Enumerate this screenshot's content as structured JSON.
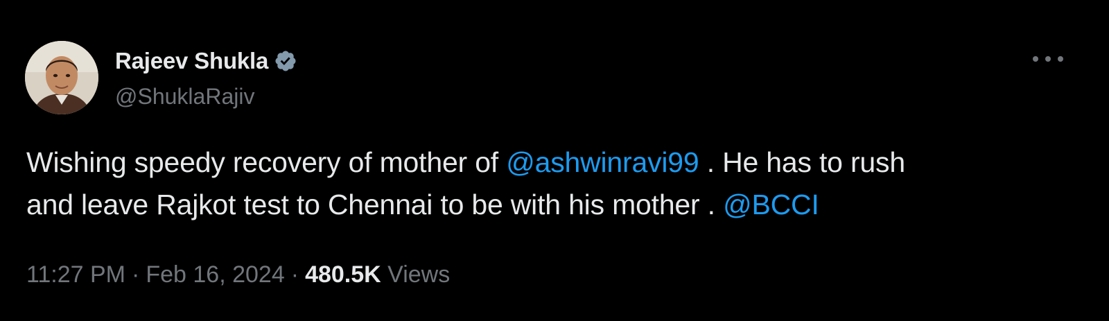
{
  "user": {
    "display_name": "Rajeev Shukla",
    "handle": "@ShuklaRajiv",
    "verified": true,
    "avatar": "profile-photo"
  },
  "tweet": {
    "segments": [
      {
        "type": "text",
        "value": "Wishing speedy recovery of mother of "
      },
      {
        "type": "mention",
        "value": "@ashwinravi99"
      },
      {
        "type": "text",
        "value": " . He has to rush"
      },
      {
        "type": "text",
        "value": "and leave Rajkot test to Chennai to be with his mother . "
      },
      {
        "type": "mention",
        "value": "@BCCI"
      }
    ]
  },
  "meta": {
    "time": "11:27 PM",
    "separator": "·",
    "date": "Feb 16, 2024",
    "views_count": "480.5K",
    "views_label": "Views"
  },
  "icons": {
    "more": "more-options-icon",
    "verified": "verified-badge-icon"
  },
  "colors": {
    "background": "#000000",
    "primary_text": "#e7e9ea",
    "secondary_text": "#71767b",
    "link": "#1d9bf0",
    "verified_badge": "#829aab"
  }
}
